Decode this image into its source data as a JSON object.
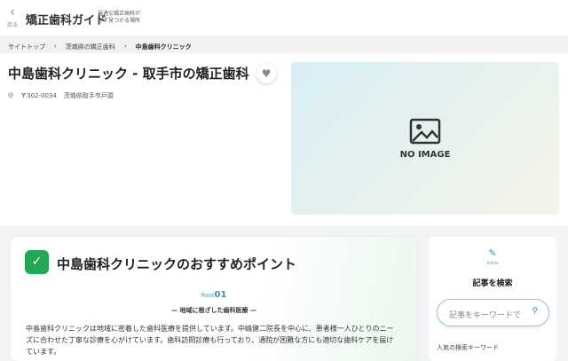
{
  "header": {
    "back_label": "戻る",
    "logo": "矯正歯科ガイド",
    "tagline_1": "最適な矯正歯科が",
    "tagline_2": "必ず見つかる場所"
  },
  "breadcrumb": [
    "サイトトップ",
    "茨城県の矯正歯科",
    "中島歯科クリニック"
  ],
  "clinic": {
    "title": "中島歯科クリニック - 取手市の矯正歯科",
    "zip": "〒302-0034",
    "address": "茨城県取手市戸頭",
    "no_image": "NO IMAGE"
  },
  "points": {
    "heading": "中島歯科クリニックのおすすめポイント",
    "point_label": "Point",
    "point_num": "01",
    "subtitle": "— 地域に根ざした歯科医療 —",
    "text": "中島歯科クリニックは地域に密着した歯科医療を提供しています。中嶋健二院長を中心に、患者様一人ひとりのニーズに合わせた丁寧な診療を心がけています。歯科訪問診療も行っており、通院が困難な方にも適切な歯科ケアを届けています。"
  },
  "sidebar": {
    "icon_label": "Article",
    "title": "記事を検索",
    "search_placeholder": "記事をキーワードで",
    "popular": "人気の検索キーワード"
  }
}
